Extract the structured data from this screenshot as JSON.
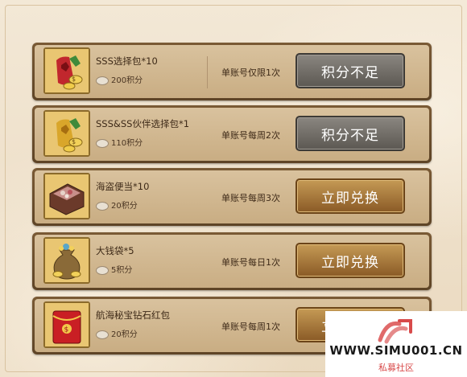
{
  "items": [
    {
      "name": "SSS选择包*10",
      "points": "200积分",
      "limit": "单账号仅限1次",
      "button": "积分不足",
      "button_state": "disabled",
      "icon": "red-pouch-coins-icon"
    },
    {
      "name": "SSS&SS伙伴选择包*1",
      "points": "110积分",
      "limit": "单账号每周2次",
      "button": "积分不足",
      "button_state": "disabled",
      "icon": "gold-pouch-coins-icon"
    },
    {
      "name": "海盗便当*10",
      "points": "20积分",
      "limit": "单账号每周3次",
      "button": "立即兑换",
      "button_state": "enabled",
      "icon": "bento-box-icon"
    },
    {
      "name": "大钱袋*5",
      "points": "5积分",
      "limit": "单账号每日1次",
      "button": "立即兑换",
      "button_state": "enabled",
      "icon": "money-bag-icon"
    },
    {
      "name": "航海秘宝钻石红包",
      "points": "20积分",
      "limit": "单账号每周1次",
      "button": "立即兑换",
      "button_state": "enabled",
      "icon": "red-envelope-icon"
    }
  ],
  "watermark": {
    "url": "WWW.SIMU001.CN",
    "subtitle": "私募社区"
  },
  "colors": {
    "disabled_button": "#6f6b66",
    "enabled_button": "#a87738",
    "row_border": "#6b4d2c",
    "panel_bg": "#efe3cf"
  }
}
